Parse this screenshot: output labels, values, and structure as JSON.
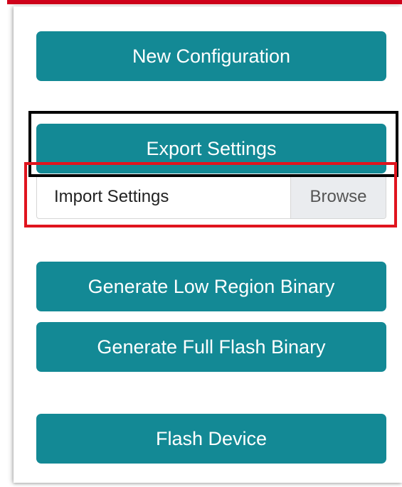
{
  "buttons": {
    "new_configuration": "New Configuration",
    "export_settings": "Export Settings",
    "generate_low_region": "Generate Low Region Binary",
    "generate_full_flash": "Generate Full Flash Binary",
    "flash_device": "Flash Device"
  },
  "import_settings": {
    "label": "Import Settings",
    "browse_label": "Browse"
  },
  "colors": {
    "button_bg": "#138995",
    "button_text": "#ffffff",
    "top_bar": "#d0021b",
    "highlight_black": "#000000",
    "highlight_red": "#e0141e"
  }
}
